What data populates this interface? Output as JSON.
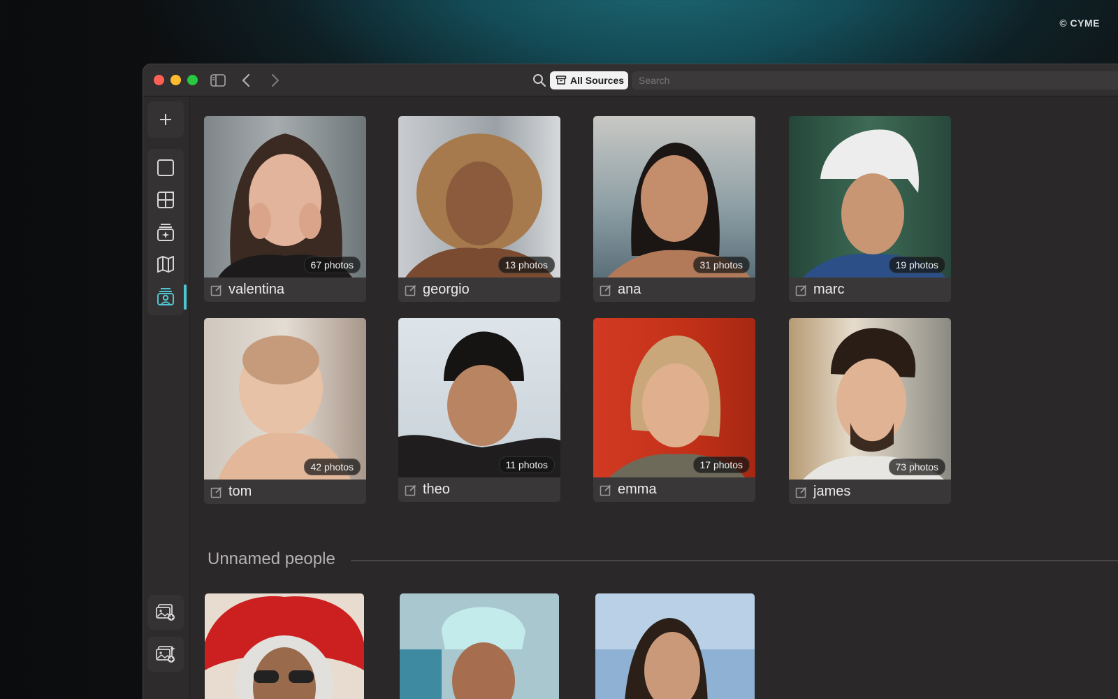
{
  "watermark": "© CYME",
  "colors": {
    "accent": "#4fc5d1",
    "window_bg": "#2b2829",
    "pill_bg": "#f2f2f2"
  },
  "titlebar": {
    "icons": [
      "sidebar-toggle-icon",
      "back-chevron-icon",
      "forward-chevron-icon"
    ],
    "sources_label": "All Sources",
    "search_placeholder": "Search"
  },
  "sidebar": {
    "top_icon": "plus-icon",
    "nav_icons": [
      "square-icon",
      "grid-icon",
      "stack-sparkle-icon",
      "map-icon",
      "people-icon"
    ],
    "active": "people-icon",
    "bottom_icons": [
      "add-photos-icon",
      "import-photos-icon"
    ]
  },
  "people": [
    {
      "name": "valentina",
      "count": "67 photos"
    },
    {
      "name": "georgio",
      "count": "13 photos"
    },
    {
      "name": "ana",
      "count": "31 photos"
    },
    {
      "name": "marc",
      "count": "19 photos"
    },
    {
      "name": "tom",
      "count": "42 photos"
    },
    {
      "name": "theo",
      "count": "11 photos"
    },
    {
      "name": "emma",
      "count": "17 photos"
    },
    {
      "name": "james",
      "count": "73 photos"
    }
  ],
  "unnamed": {
    "title": "Unnamed people",
    "count": 3
  }
}
